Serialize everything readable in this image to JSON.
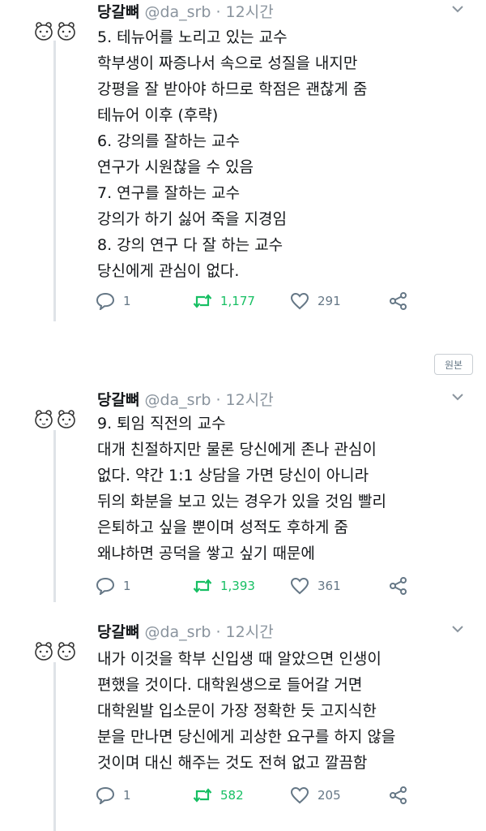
{
  "tweets": [
    {
      "name": "당갈뼈",
      "handle": "@da_srb · 12시간",
      "body": "5. 테뉴어를 노리고 있는 교수\n학부생이 짜증나서 속으로 성질을 내지만\n강평을 잘 받아야 하므로 학점은 괜찮게 줌\n테뉴어 이후 (후략)\n6. 강의를 잘하는 교수\n연구가 시원찮을 수 있음\n7. 연구를 잘하는 교수\n강의가 하기 싫어 죽을 지경임\n8. 강의 연구 다 잘 하는 교수\n당신에게 관심이 없다.",
      "replies": "1",
      "retweets": "1,177",
      "likes": "291"
    },
    {
      "name": "당갈뼈",
      "handle": "@da_srb · 12시간",
      "body": "9. 퇴임 직전의 교수\n대개 친절하지만 물론 당신에게 존나 관심이\n없다. 약간 1:1 상담을 가면 당신이 아니라\n뒤의 화분을 보고 있는 경우가 있을 것임 빨리\n은퇴하고 싶을 뿐이며 성적도 후하게 줌\n왜냐하면 공덕을 쌓고 싶기 때문에",
      "replies": "1",
      "retweets": "1,393",
      "likes": "361"
    },
    {
      "name": "당갈뼈",
      "handle": "@da_srb · 12시간",
      "body": "내가 이것을 학부 신입생 때 알았으면 인생이\n편했을 것이다. 대학원생으로 들어갈 거면\n대학원발 입소문이 가장 정확한 듯 고지식한\n분을 만나면 당신에게 괴상한 요구를 하지 않을\n것이며 대신 해주는 것도 전혀 없고 깔끔함",
      "replies": "1",
      "retweets": "582",
      "likes": "205"
    }
  ],
  "original_button": "원본",
  "icons": {
    "avatar": "two-bear-avatar-icon",
    "more": "chevron-down-icon",
    "reply": "reply-icon",
    "retweet": "retweet-icon",
    "like": "heart-icon",
    "share": "share-icon"
  },
  "colors": {
    "retweet": "#17bf63",
    "muted": "#657786",
    "text": "#14171a"
  }
}
